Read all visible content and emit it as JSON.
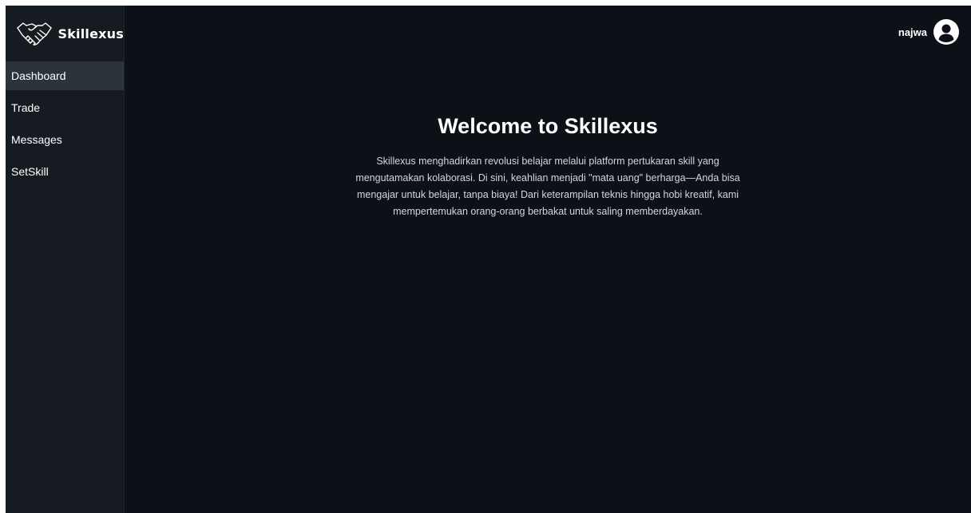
{
  "brand": {
    "name": "Skillexus",
    "logo_icon": "handshake-icon"
  },
  "sidebar": {
    "items": [
      {
        "label": "Dashboard",
        "active": true
      },
      {
        "label": "Trade",
        "active": false
      },
      {
        "label": "Messages",
        "active": false
      },
      {
        "label": "SetSkill",
        "active": false
      }
    ]
  },
  "header": {
    "username": "najwa",
    "avatar_icon": "user-circle-icon"
  },
  "main": {
    "title": "Welcome to Skillexus",
    "description": "Skillexus menghadirkan revolusi belajar melalui platform pertukaran skill yang mengutamakan kolaborasi. Di sini, keahlian menjadi \"mata uang\" berharga—Anda bisa mengajar untuk belajar, tanpa biaya! Dari keterampilan teknis hingga hobi kreatif, kami mempertemukan orang-orang berbakat untuk saling memberdayakan."
  },
  "colors": {
    "background": "#0d1117",
    "sidebar": "#161b22",
    "active_item": "#2d333b",
    "text": "#ffffff"
  }
}
